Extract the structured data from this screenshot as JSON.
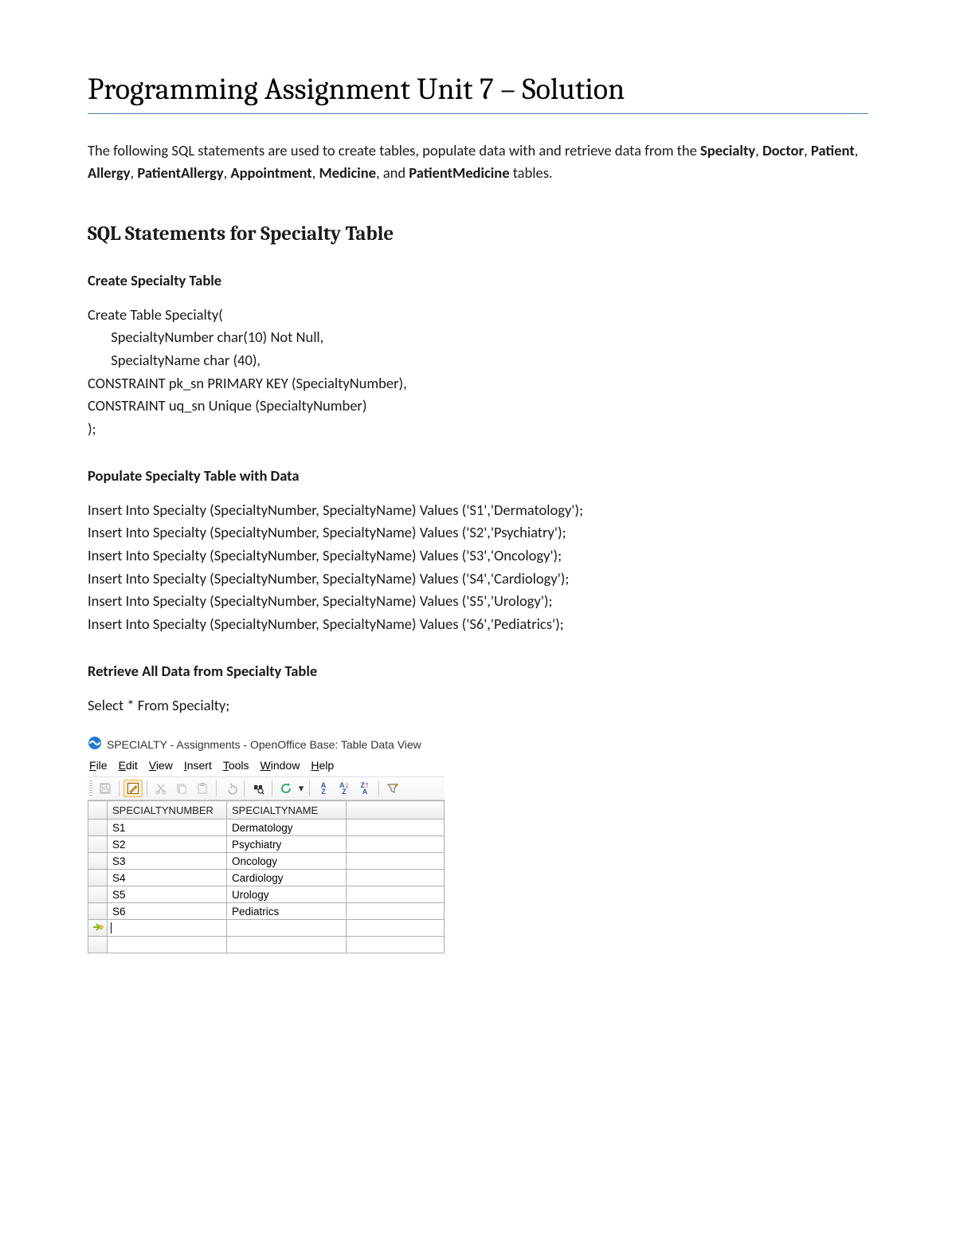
{
  "title": "Programming Assignment Unit 7 – Solution",
  "intro": {
    "pre": "The following SQL statements are used to create tables, populate data with and retrieve data from the ",
    "bold_tables": [
      "Specialty",
      "Doctor",
      "Patient",
      "Allergy",
      "PatientAllergy",
      "Appointment",
      "Medicine",
      "PatientMedicine"
    ],
    "and": ", and ",
    "post": " tables."
  },
  "section_heading": "SQL Statements for Specialty Table",
  "subs": {
    "create": "Create Specialty Table",
    "populate": "Populate Specialty Table with Data",
    "retrieve": "Retrieve All Data from Specialty Table"
  },
  "create_sql": "Create Table Specialty(\n       SpecialtyNumber char(10) Not Null,\n       SpecialtyName char (40),\nCONSTRAINT pk_sn PRIMARY KEY (SpecialtyNumber),\nCONSTRAINT uq_sn Unique (SpecialtyNumber)\n);",
  "populate_sql": "Insert Into Specialty (SpecialtyNumber, SpecialtyName) Values ('S1','Dermatology');\nInsert Into Specialty (SpecialtyNumber, SpecialtyName) Values ('S2','Psychiatry');\nInsert Into Specialty (SpecialtyNumber, SpecialtyName) Values ('S3','Oncology');\nInsert Into Specialty (SpecialtyNumber, SpecialtyName) Values ('S4','Cardiology');\nInsert Into Specialty (SpecialtyNumber, SpecialtyName) Values ('S5','Urology');\nInsert Into Specialty (SpecialtyNumber, SpecialtyName) Values ('S6','Pediatrics');",
  "retrieve_sql": "Select * From Specialty;",
  "oo": {
    "window_title": "SPECIALTY - Assignments - OpenOffice Base: Table Data View",
    "menus": [
      "File",
      "Edit",
      "View",
      "Insert",
      "Tools",
      "Window",
      "Help"
    ],
    "columns": [
      "SPECIALTYNUMBER",
      "SPECIALTYNAME"
    ],
    "rows": [
      {
        "num": "S1",
        "name": "Dermatology"
      },
      {
        "num": "S2",
        "name": "Psychiatry"
      },
      {
        "num": "S3",
        "name": "Oncology"
      },
      {
        "num": "S4",
        "name": "Cardiology"
      },
      {
        "num": "S5",
        "name": "Urology"
      },
      {
        "num": "S6",
        "name": "Pediatrics"
      }
    ]
  }
}
